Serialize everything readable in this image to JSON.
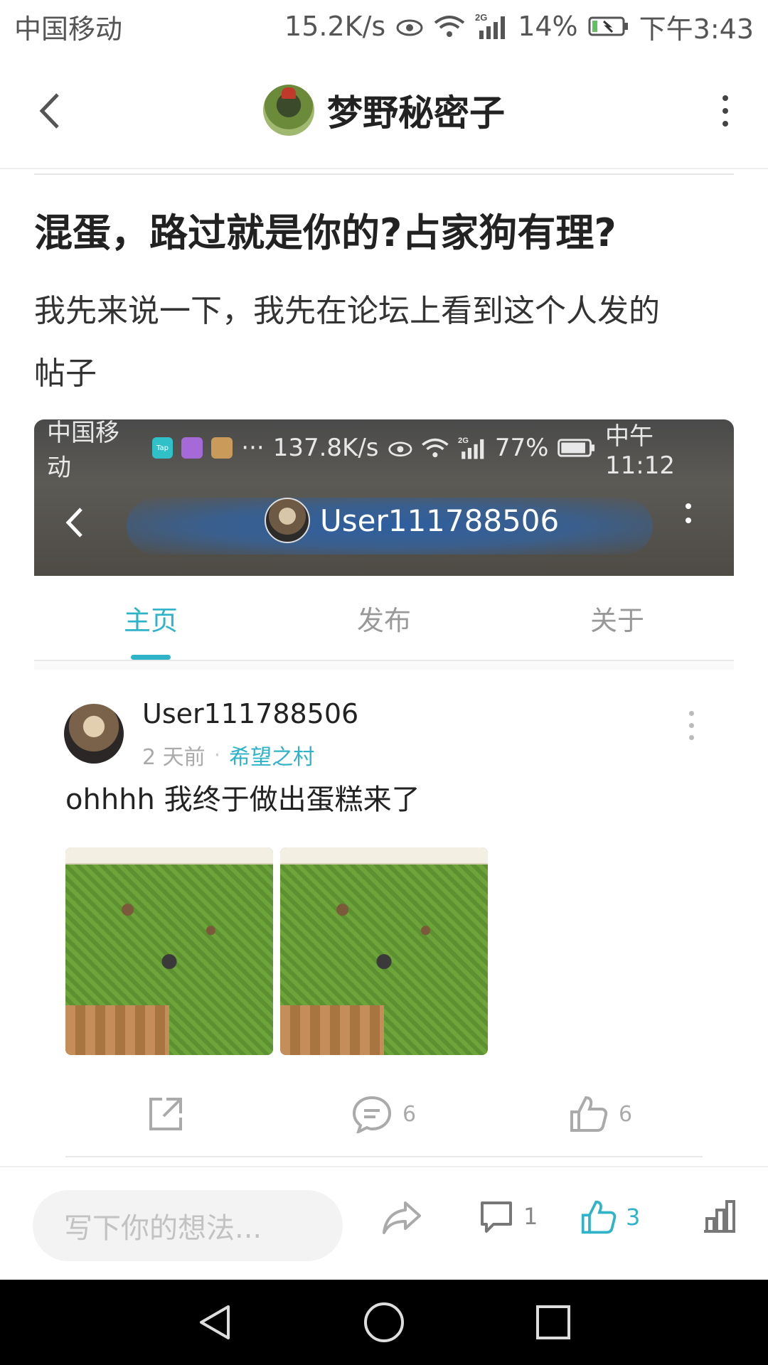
{
  "status_bar": {
    "carrier": "中国移动",
    "speed": "15.2K/s",
    "network": "2G",
    "battery": "14%",
    "time": "下午3:43"
  },
  "app_bar": {
    "title": "梦野秘密子"
  },
  "article": {
    "title": "混蛋，路过就是你的?占家狗有理?",
    "body_line1": "我先来说一下，我先在论坛上看到这个人发的",
    "body_line2": "帖子"
  },
  "embedded": {
    "status": {
      "carrier": "中国移动",
      "app_badge": "Tap",
      "ellipsis": "···",
      "speed": "137.8K/s",
      "network": "2G",
      "battery": "77%",
      "time": "中午11:12"
    },
    "nav_user": "User111788506",
    "tabs": [
      "主页",
      "发布",
      "关于"
    ],
    "post": {
      "user": "User111788506",
      "time": "2 天前",
      "separator": "·",
      "tag": "希望之村",
      "text": "ohhhh 我终于做出蛋糕来了",
      "comment_count": "6",
      "like_count": "6"
    }
  },
  "bottom_bar": {
    "input_placeholder": "写下你的想法...",
    "comment_count": "1",
    "like_count": "3"
  },
  "colors": {
    "accent": "#2fb3c8"
  }
}
